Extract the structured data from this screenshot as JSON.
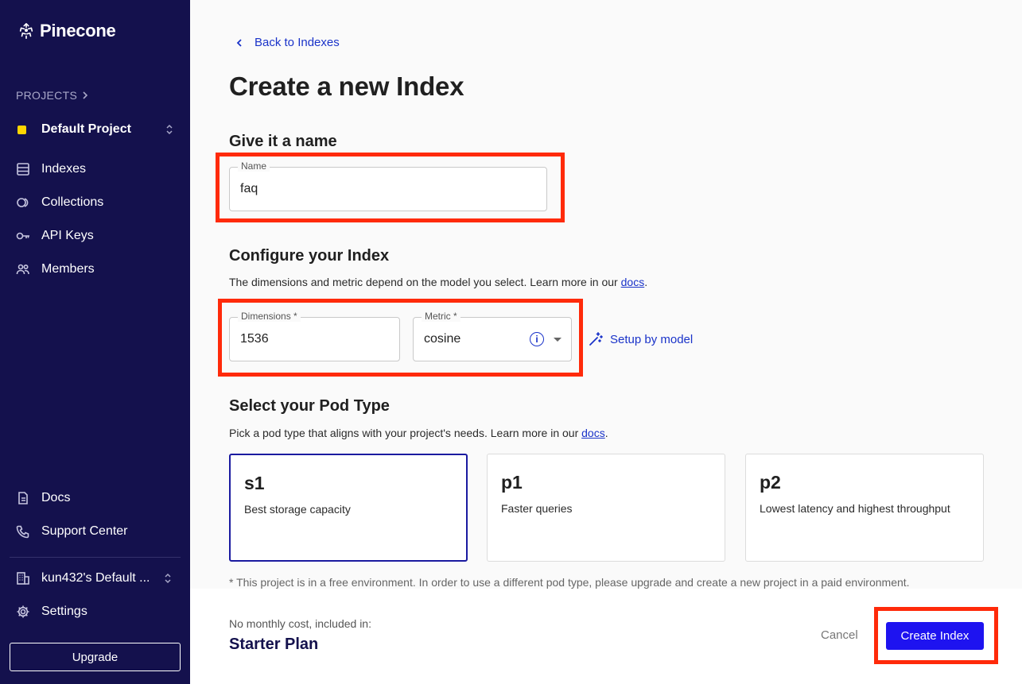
{
  "sidebar": {
    "brand": "Pinecone",
    "projects_label": "PROJECTS",
    "project_name": "Default Project",
    "nav": [
      {
        "label": "Indexes",
        "icon": "database-icon"
      },
      {
        "label": "Collections",
        "icon": "collections-icon"
      },
      {
        "label": "API Keys",
        "icon": "key-icon"
      },
      {
        "label": "Members",
        "icon": "members-icon"
      }
    ],
    "bottom_nav": [
      {
        "label": "Docs",
        "icon": "document-icon"
      },
      {
        "label": "Support Center",
        "icon": "phone-icon"
      }
    ],
    "org_name": "kun432's Default ...",
    "settings_label": "Settings",
    "upgrade_label": "Upgrade"
  },
  "main": {
    "back_label": "Back to Indexes",
    "title": "Create a new Index",
    "name_section": {
      "heading": "Give it a name",
      "field_label": "Name",
      "field_value": "faq"
    },
    "config_section": {
      "heading": "Configure your Index",
      "description": "The dimensions and metric depend on the model you select. Learn more in our ",
      "link": "docs",
      "dimensions_label": "Dimensions *",
      "dimensions_value": "1536",
      "metric_label": "Metric *",
      "metric_value": "cosine",
      "setup_label": "Setup by model"
    },
    "pod_section": {
      "heading": "Select your Pod Type",
      "description": "Pick a pod type that aligns with your project's needs. Learn more in our ",
      "link": "docs",
      "pods": [
        {
          "name": "s1",
          "description": "Best storage capacity",
          "selected": true
        },
        {
          "name": "p1",
          "description": "Faster queries",
          "selected": false
        },
        {
          "name": "p2",
          "description": "Lowest latency and highest throughput",
          "selected": false
        }
      ],
      "note": "* This project is in a free environment. In order to use a different pod type, please upgrade and create a new project in a paid environment."
    }
  },
  "footer": {
    "cost_note": "No monthly cost, included in:",
    "plan": "Starter Plan",
    "cancel_label": "Cancel",
    "create_label": "Create Index"
  },
  "colors": {
    "sidebar_bg": "#14114d",
    "accent": "#1a33c9",
    "primary_button": "#1e13f0",
    "highlight_box": "#ff2a0a"
  }
}
